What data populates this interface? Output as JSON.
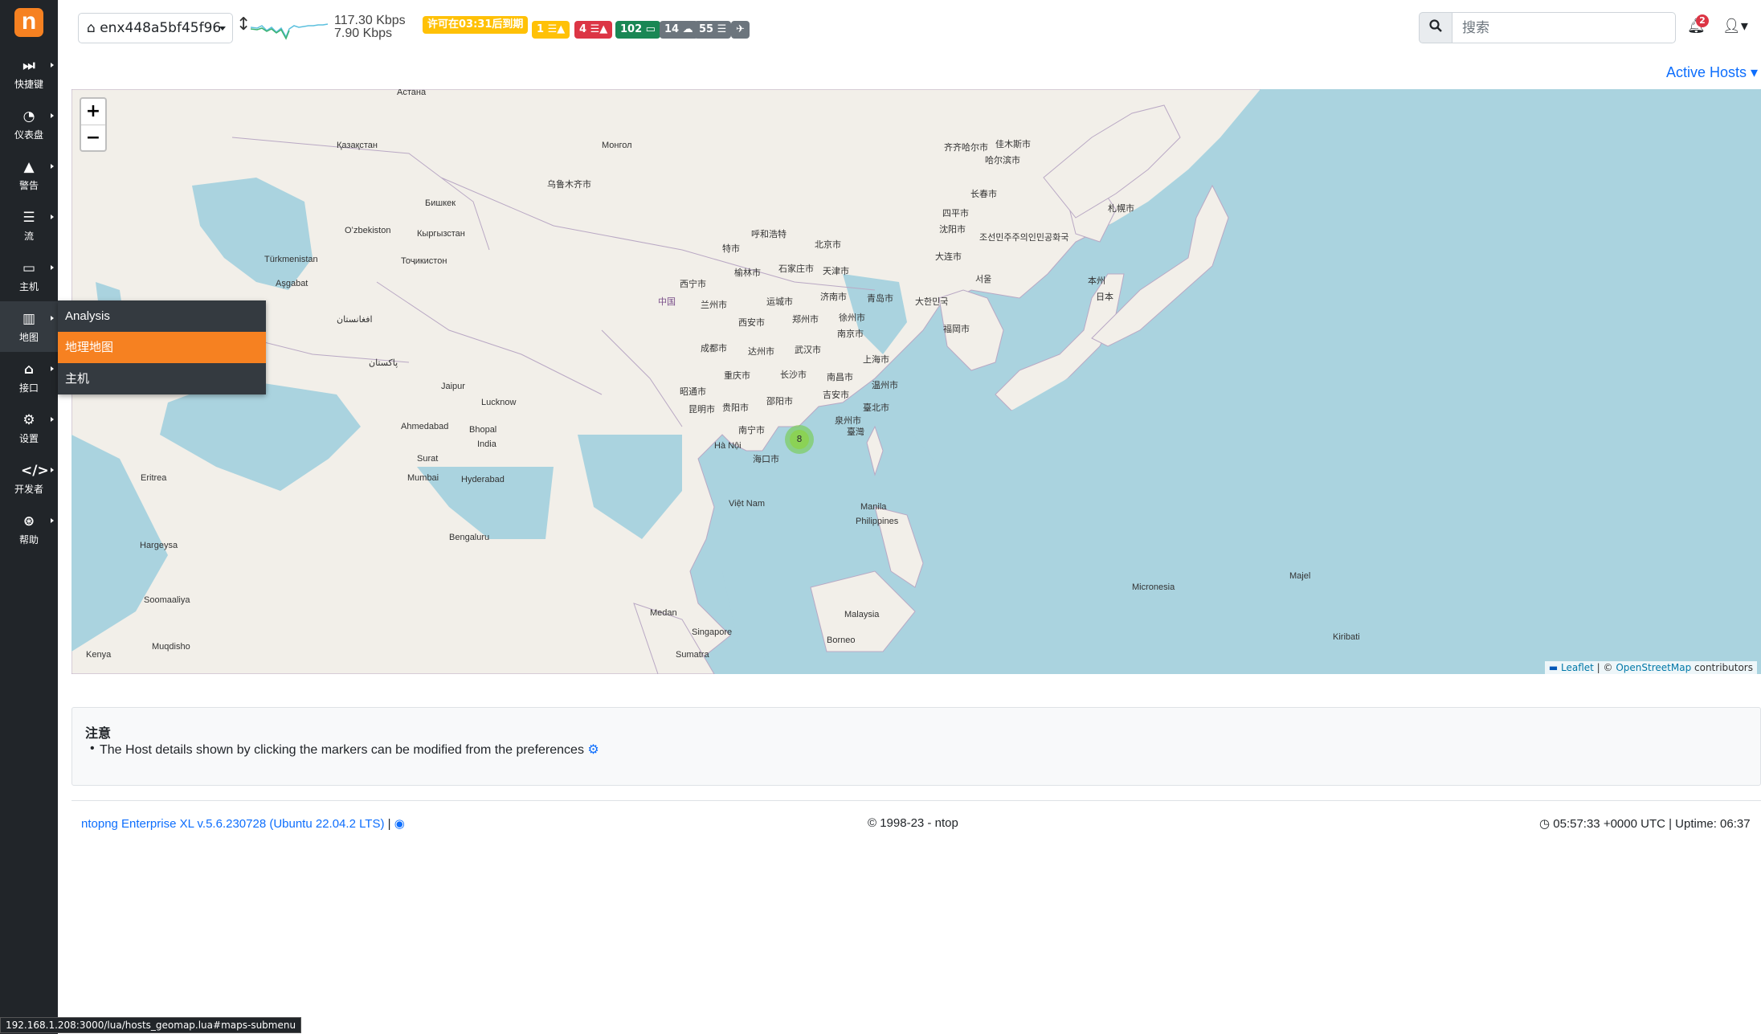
{
  "sidebar": {
    "items": [
      {
        "label": "快捷键",
        "icon": "fast-forward-icon"
      },
      {
        "label": "仪表盘",
        "icon": "gauge-icon"
      },
      {
        "label": "警告",
        "icon": "warning-icon"
      },
      {
        "label": "流",
        "icon": "list-icon"
      },
      {
        "label": "主机",
        "icon": "laptop-icon"
      },
      {
        "label": "地图",
        "icon": "map-icon"
      },
      {
        "label": "接口",
        "icon": "ethernet-icon"
      },
      {
        "label": "设置",
        "icon": "gear-icon"
      },
      {
        "label": "开发者",
        "icon": "code-icon"
      },
      {
        "label": "帮助",
        "icon": "help-icon"
      }
    ],
    "submenu": [
      "Analysis",
      "地理地图",
      "主机"
    ]
  },
  "header": {
    "interface": "enx448a5bf45f96",
    "rate_up": "117.30 Kbps",
    "rate_down": "7.90 Kbps",
    "license": "许可在03:31后到期",
    "badges": [
      {
        "text": "1",
        "color": "#ffc107"
      },
      {
        "text": "4",
        "color": "#dc3545"
      },
      {
        "text": "102",
        "color": "#198754"
      },
      {
        "text": "14",
        "color": "#6c757d"
      },
      {
        "text": "55",
        "color": "#6c757d"
      },
      {
        "text": "✈",
        "color": "#6c757d"
      }
    ],
    "search_placeholder": "搜索",
    "notifications": "2"
  },
  "map": {
    "view_selector": "Active Hosts",
    "zoom_in": "+",
    "zoom_out": "−",
    "cluster_count": "8",
    "attribution_leaflet": "Leaflet",
    "attribution_osm": "OpenStreetMap",
    "attribution_suffix": "contributors"
  },
  "note": {
    "title": "注意",
    "text": "The Host details shown by clicking the markers can be modified from the preferences"
  },
  "footer": {
    "version": "ntopng Enterprise XL v.5.6.230728 (Ubuntu 22.04.2 LTS)",
    "copyright": "© 1998-23 - ntop",
    "time": "05:57:33 +0000 UTC | Uptime: 06:37"
  },
  "status_url": "192.168.1.208:3000/lua/hosts_geomap.lua#maps-submenu"
}
